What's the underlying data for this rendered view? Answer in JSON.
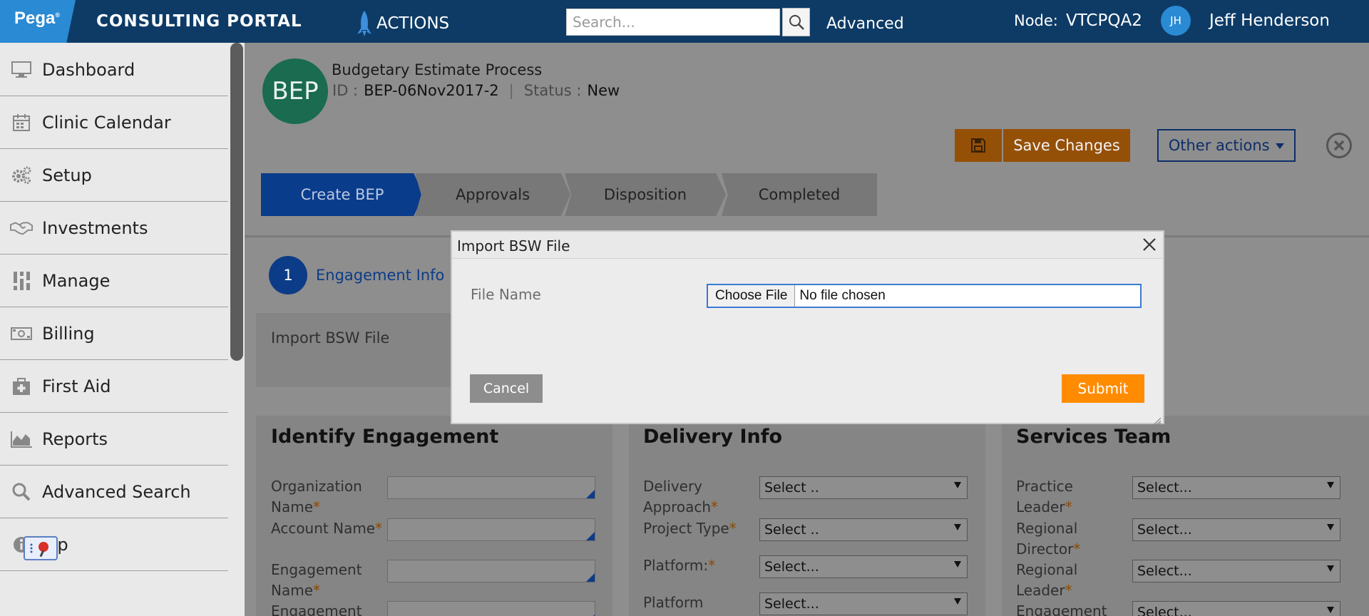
{
  "header": {
    "logo": "Pega",
    "logo_mark": "®",
    "portal_title": "CONSULTING PORTAL",
    "actions_label": "ACTIONS",
    "search_placeholder": "Search...",
    "advanced_label": "Advanced",
    "node_label": "Node:",
    "node_value": "VTCPQA2",
    "user_initials": "JH",
    "user_name": "Jeff Henderson"
  },
  "sidebar": {
    "items": [
      {
        "label": "Dashboard",
        "icon": "monitor-icon"
      },
      {
        "label": "Clinic Calendar",
        "icon": "calendar-icon"
      },
      {
        "label": "Setup",
        "icon": "gears-icon"
      },
      {
        "label": "Investments",
        "icon": "handshake-icon"
      },
      {
        "label": "Manage",
        "icon": "sliders-icon"
      },
      {
        "label": "Billing",
        "icon": "money-icon"
      },
      {
        "label": "First Aid",
        "icon": "first-aid-kit-icon"
      },
      {
        "label": "Reports",
        "icon": "area-chart-icon"
      },
      {
        "label": "Advanced Search",
        "icon": "search-icon"
      },
      {
        "label": "elp",
        "icon": "info-icon"
      }
    ]
  },
  "case": {
    "avatar_text": "BEP",
    "title": "Budgetary Estimate Process",
    "id_label": "ID :",
    "id_value": "BEP-06Nov2017-2",
    "status_label": "Status :",
    "status_value": "New",
    "save_changes_label": "Save Changes",
    "other_actions_label": "Other actions"
  },
  "stages": [
    {
      "label": "Create BEP",
      "active": true
    },
    {
      "label": "Approvals",
      "active": false
    },
    {
      "label": "Disposition",
      "active": false
    },
    {
      "label": "Completed",
      "active": false
    }
  ],
  "step": {
    "number": "1",
    "label": "Engagement Info"
  },
  "import_panel_label": "Import BSW File",
  "sections": {
    "identify": {
      "title": "Identify Engagement",
      "fields": [
        "Organization\nName",
        "Account Name",
        "Engagement\nName",
        "Engagement"
      ]
    },
    "delivery": {
      "title": "Delivery Info",
      "fields": [
        {
          "label": "Delivery\nApproach",
          "value": "Select .."
        },
        {
          "label": "Project Type",
          "value": "Select .."
        },
        {
          "label": "Platform:",
          "value": "Select..."
        },
        {
          "label": "Platform",
          "value": "Select..."
        }
      ]
    },
    "team": {
      "title": "Services Team",
      "fields": [
        {
          "label": "Practice\nLeader",
          "value": "Select..."
        },
        {
          "label": "Regional\nDirector",
          "value": "Select..."
        },
        {
          "label": "Regional\nLeader",
          "value": "Select..."
        },
        {
          "label": "Engagement",
          "value": "Select..."
        }
      ]
    }
  },
  "modal": {
    "title": "Import BSW File",
    "file_label": "File Name",
    "choose_file_label": "Choose File",
    "file_status": "No file chosen",
    "cancel_label": "Cancel",
    "submit_label": "Submit"
  },
  "colors": {
    "topbar": "#0d3b66",
    "accent_blue": "#0c3c87",
    "orange": "#ff8c00"
  }
}
